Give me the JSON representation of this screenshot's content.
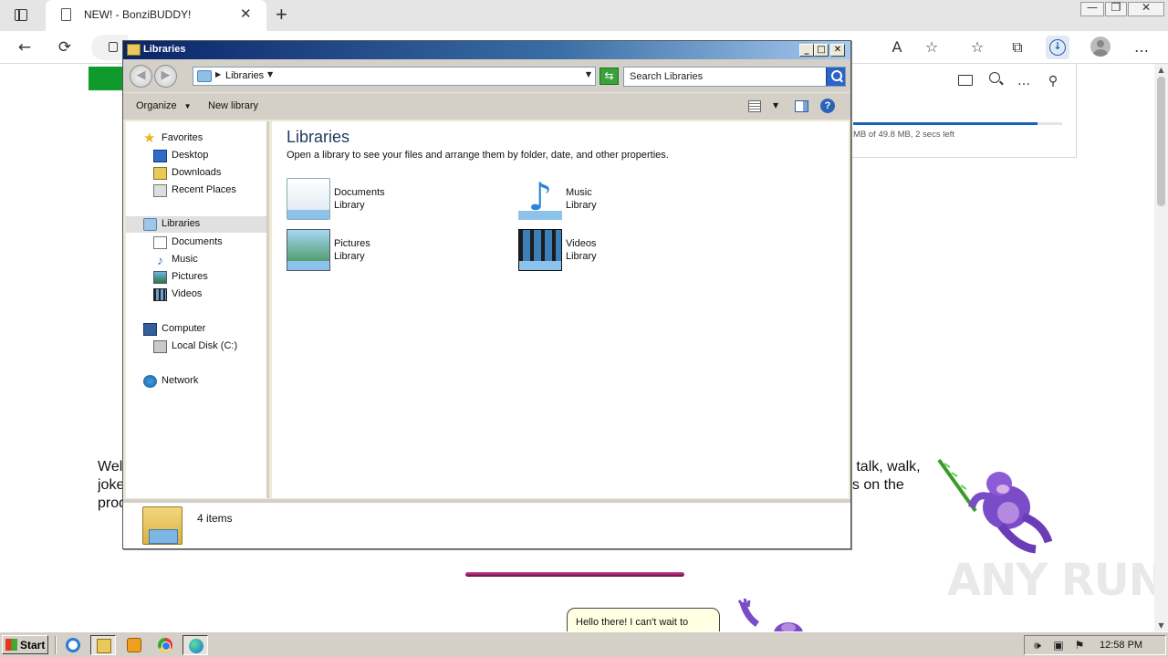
{
  "browser": {
    "tab_title": "NEW! - BonziBUDDY!",
    "tab_close": "✕",
    "new_tab": "+",
    "window_controls": {
      "minimize": "—",
      "maximize": "❐",
      "close": "✕"
    },
    "toolbar": {
      "back": "←",
      "refresh": "⟳",
      "read_aloud": "A",
      "favorites_add": "☆",
      "favorites": "☆",
      "collections": "⧉",
      "download": "↓",
      "more": "…"
    }
  },
  "downloads_panel": {
    "status": "MB of 49.8 MB, 2 secs left",
    "progress_fraction": 0.88,
    "more": "…",
    "pin": "⚲"
  },
  "webpage": {
    "welcome_left": "Wel\njoke\nprod",
    "welcome_right_line1": "n talk, walk,",
    "welcome_right_line2": "es on the",
    "speech_bubble": "Hello there! I can't wait to",
    "watermark": "ANY RUN"
  },
  "explorer": {
    "title": "Libraries",
    "caption": {
      "min": "_",
      "max": "□",
      "close": "✕"
    },
    "address_crumb": "Libraries",
    "search_placeholder": "Search Libraries",
    "commands": {
      "organize": "Organize",
      "new_library": "New library",
      "help": "?"
    },
    "nav_pane": {
      "favorites": "Favorites",
      "desktop": "Desktop",
      "downloads": "Downloads",
      "recent_places": "Recent Places",
      "libraries": "Libraries",
      "documents": "Documents",
      "music": "Music",
      "pictures": "Pictures",
      "videos": "Videos",
      "computer": "Computer",
      "local_disk": "Local Disk (C:)",
      "network": "Network"
    },
    "content": {
      "heading": "Libraries",
      "description": "Open a library to see your files and arrange them by folder, date, and other properties.",
      "libraries": [
        {
          "name": "Documents",
          "type": "Library"
        },
        {
          "name": "Music",
          "type": "Library"
        },
        {
          "name": "Pictures",
          "type": "Library"
        },
        {
          "name": "Videos",
          "type": "Library"
        }
      ]
    },
    "details": {
      "item_count": "4 items"
    }
  },
  "taskbar": {
    "start_label": "Start",
    "clock": "12:58 PM"
  }
}
